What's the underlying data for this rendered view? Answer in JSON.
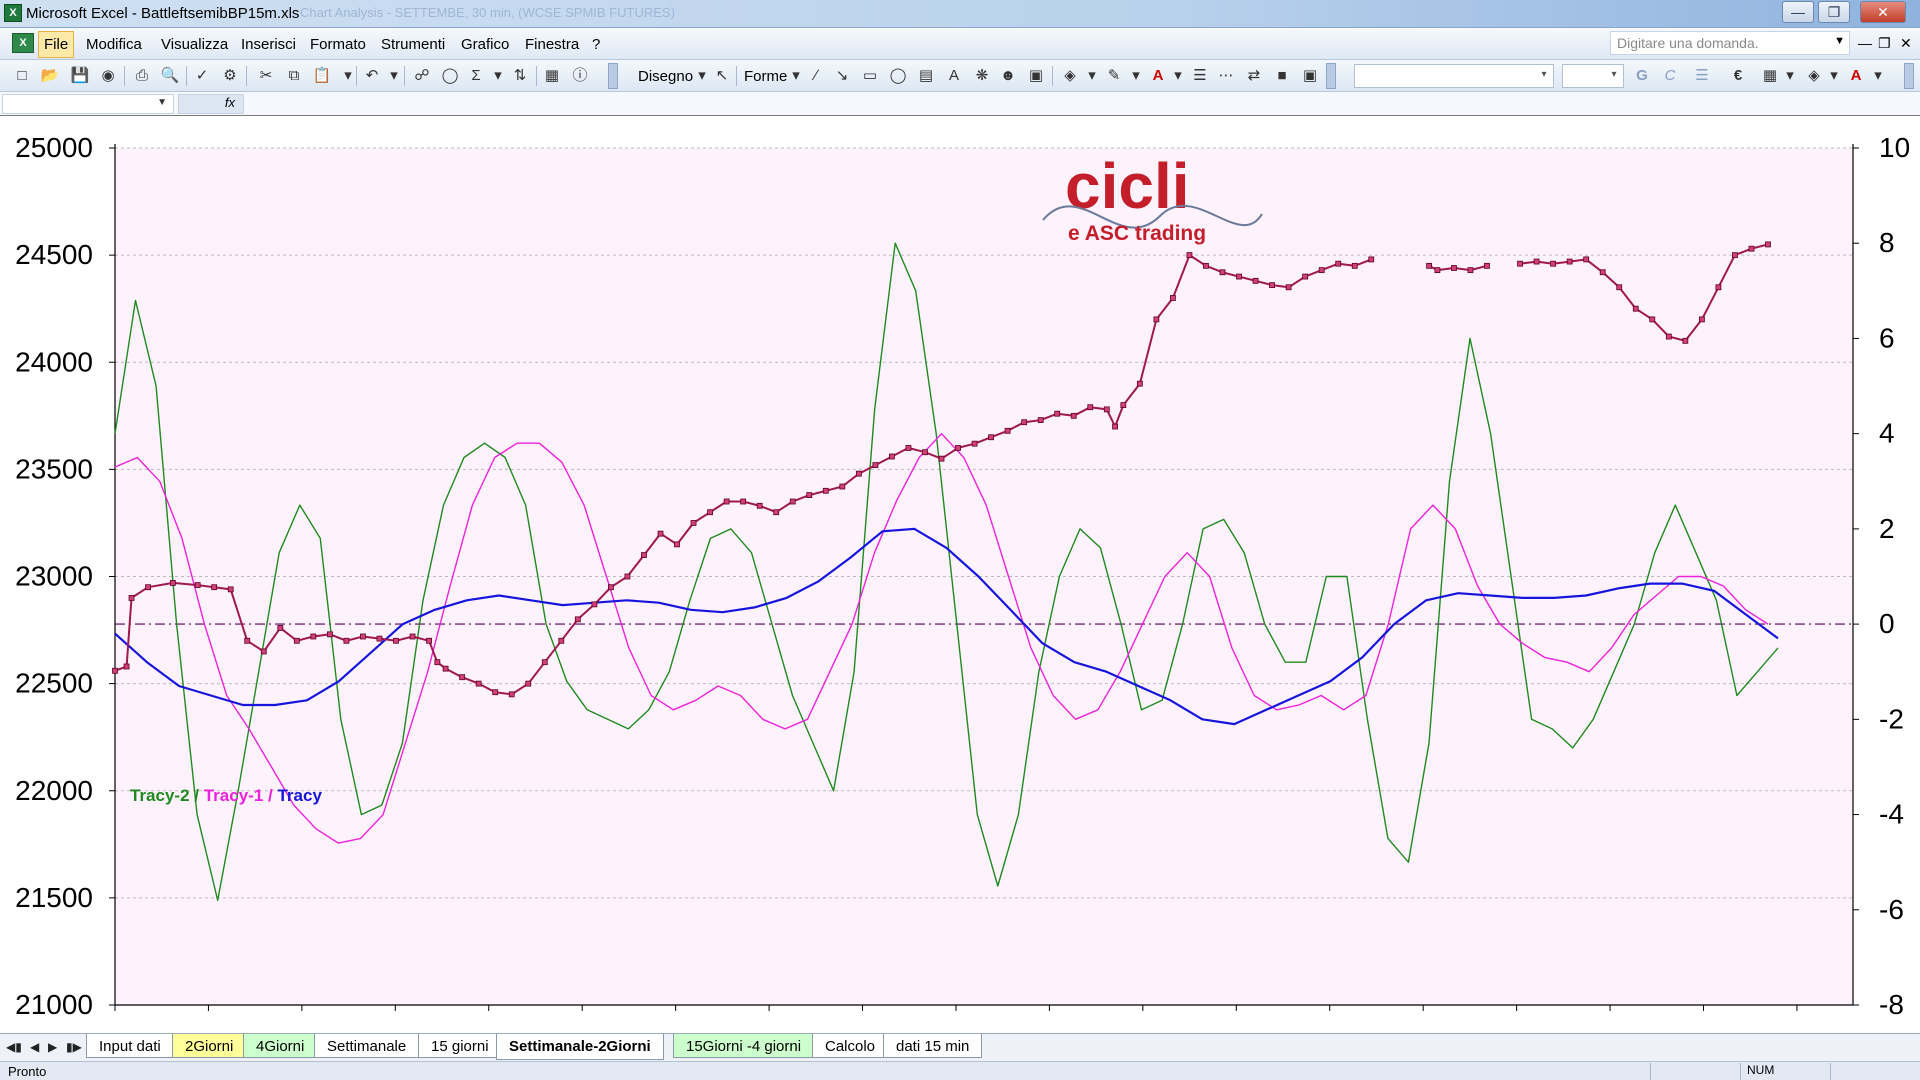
{
  "window": {
    "title": "Microsoft Excel - BattleftsemibBP15m.xls",
    "ghost_title": "Chart Analysis - SETTEMBE, 30 min, (WCSE SPMIB FUTURES)"
  },
  "menu": {
    "items": [
      "File",
      "Modifica",
      "Visualizza",
      "Inserisci",
      "Formato",
      "Strumenti",
      "Grafico",
      "Finestra",
      "?"
    ],
    "help_placeholder": "Digitare una domanda."
  },
  "toolbar": {
    "disegno_label": "Disegno",
    "forme_label": "Forme"
  },
  "sheet_tabs": [
    "Input dati",
    "2Giorni",
    "4Giorni",
    "Settimanale",
    "15 giorni",
    "Settimanale-2Giorni",
    "15Giorni -4 giorni",
    "Calcolo",
    "dati 15 min"
  ],
  "active_tab": "Settimanale-2Giorni",
  "status": {
    "left": "Pronto",
    "num": "NUM"
  },
  "logo": {
    "main": "cicli",
    "sub": "e ASC trading"
  },
  "colors": {
    "plot_bg": "#fef2fc",
    "price": "#a01850",
    "tracy2": "#1f8a1f",
    "tracy1": "#ee22dd",
    "tracy": "#1515dd",
    "zero_line": "#7a2a7a",
    "logo_red": "#c41e2a"
  },
  "chart_data": {
    "type": "line",
    "legend": [
      {
        "text": "Tracy-2",
        "color": "#1f8a1f"
      },
      {
        "text": "Tracy-1",
        "color": "#ee22dd"
      },
      {
        "text": "Tracy",
        "color": "#1515dd"
      }
    ],
    "y_left": {
      "min": 21000,
      "max": 25000,
      "step": 500,
      "ticks": [
        "25000",
        "24500",
        "24000",
        "23500",
        "23000",
        "22500",
        "22000",
        "21500",
        "21000"
      ]
    },
    "y_right": {
      "min": -8,
      "max": 10,
      "step": 2,
      "ticks": [
        "10",
        "8",
        "6",
        "4",
        "2",
        "0",
        "-2",
        "-4",
        "-6",
        "-8"
      ]
    },
    "x_range": [
      0,
      100
    ],
    "grid": true,
    "zero_line_right": 0,
    "price": [
      [
        0,
        22560
      ],
      [
        0.7,
        22580
      ],
      [
        1,
        22900
      ],
      [
        2,
        22950
      ],
      [
        3.5,
        22970
      ],
      [
        5,
        22960
      ],
      [
        6,
        22950
      ],
      [
        7,
        22940
      ],
      [
        8,
        22700
      ],
      [
        9,
        22650
      ],
      [
        10,
        22760
      ],
      [
        11,
        22700
      ],
      [
        12,
        22720
      ],
      [
        13,
        22730
      ],
      [
        14,
        22700
      ],
      [
        15,
        22720
      ],
      [
        16,
        22710
      ],
      [
        17,
        22700
      ],
      [
        18,
        22720
      ],
      [
        19,
        22700
      ],
      [
        19.5,
        22600
      ],
      [
        20,
        22570
      ],
      [
        21,
        22530
      ],
      [
        22,
        22500
      ],
      [
        23,
        22460
      ],
      [
        24,
        22450
      ],
      [
        25,
        22500
      ],
      [
        26,
        22600
      ],
      [
        27,
        22700
      ],
      [
        28,
        22800
      ],
      [
        29,
        22870
      ],
      [
        30,
        22950
      ],
      [
        31,
        23000
      ],
      [
        32,
        23100
      ],
      [
        33,
        23200
      ],
      [
        34,
        23150
      ],
      [
        35,
        23250
      ],
      [
        36,
        23300
      ],
      [
        37,
        23350
      ],
      [
        38,
        23350
      ],
      [
        39,
        23330
      ],
      [
        40,
        23300
      ],
      [
        41,
        23350
      ],
      [
        42,
        23380
      ],
      [
        43,
        23400
      ],
      [
        44,
        23420
      ],
      [
        45,
        23480
      ],
      [
        46,
        23520
      ],
      [
        47,
        23560
      ],
      [
        48,
        23600
      ],
      [
        49,
        23580
      ],
      [
        50,
        23550
      ],
      [
        51,
        23600
      ],
      [
        52,
        23620
      ],
      [
        53,
        23650
      ],
      [
        54,
        23680
      ],
      [
        55,
        23720
      ],
      [
        56,
        23730
      ],
      [
        57,
        23760
      ],
      [
        58,
        23750
      ],
      [
        59,
        23790
      ],
      [
        60,
        23780
      ],
      [
        60.5,
        23700
      ],
      [
        61,
        23800
      ],
      [
        62,
        23900
      ],
      [
        63,
        24200
      ],
      [
        64,
        24300
      ],
      [
        65,
        24500
      ],
      [
        66,
        24450
      ],
      [
        67,
        24420
      ],
      [
        68,
        24400
      ],
      [
        69,
        24380
      ],
      [
        70,
        24360
      ],
      [
        71,
        24350
      ],
      [
        72,
        24400
      ],
      [
        73,
        24430
      ],
      [
        74,
        24460
      ],
      [
        75,
        24450
      ],
      [
        76,
        24480
      ],
      [
        79,
        null
      ],
      [
        79.5,
        24450
      ],
      [
        80,
        24430
      ],
      [
        81,
        24440
      ],
      [
        82,
        24430
      ],
      [
        83,
        24450
      ],
      [
        84,
        null
      ],
      [
        85,
        24460
      ],
      [
        86,
        24470
      ],
      [
        87,
        24460
      ],
      [
        88,
        24470
      ],
      [
        89,
        24480
      ],
      [
        90,
        24420
      ],
      [
        91,
        24350
      ],
      [
        92,
        24250
      ],
      [
        93,
        24200
      ],
      [
        94,
        24120
      ],
      [
        95,
        24100
      ],
      [
        96,
        24200
      ],
      [
        97,
        24350
      ],
      [
        98,
        24500
      ],
      [
        99,
        24530
      ],
      [
        100,
        24550
      ]
    ],
    "tracy2": [
      [
        0,
        4
      ],
      [
        1,
        6.8
      ],
      [
        2,
        5
      ],
      [
        3,
        0
      ],
      [
        4,
        -4
      ],
      [
        5,
        -5.8
      ],
      [
        6,
        -3.5
      ],
      [
        7,
        -1
      ],
      [
        8,
        1.5
      ],
      [
        9,
        2.5
      ],
      [
        10,
        1.8
      ],
      [
        11,
        -2
      ],
      [
        12,
        -4
      ],
      [
        13,
        -3.8
      ],
      [
        14,
        -2.5
      ],
      [
        15,
        0.5
      ],
      [
        16,
        2.5
      ],
      [
        17,
        3.5
      ],
      [
        18,
        3.8
      ],
      [
        19,
        3.5
      ],
      [
        20,
        2.5
      ],
      [
        21,
        0
      ],
      [
        22,
        -1.2
      ],
      [
        23,
        -1.8
      ],
      [
        24,
        -2
      ],
      [
        25,
        -2.2
      ],
      [
        26,
        -1.8
      ],
      [
        27,
        -1
      ],
      [
        28,
        0.5
      ],
      [
        29,
        1.8
      ],
      [
        30,
        2
      ],
      [
        31,
        1.5
      ],
      [
        32,
        0
      ],
      [
        33,
        -1.5
      ],
      [
        34,
        -2.5
      ],
      [
        35,
        -3.5
      ],
      [
        36,
        -1
      ],
      [
        37,
        4.5
      ],
      [
        38,
        8
      ],
      [
        39,
        7
      ],
      [
        40,
        4
      ],
      [
        41,
        0
      ],
      [
        42,
        -4
      ],
      [
        43,
        -5.5
      ],
      [
        44,
        -4
      ],
      [
        45,
        -1
      ],
      [
        46,
        1
      ],
      [
        47,
        2
      ],
      [
        48,
        1.6
      ],
      [
        49,
        0
      ],
      [
        50,
        -1.8
      ],
      [
        51,
        -1.6
      ],
      [
        52,
        0
      ],
      [
        53,
        2
      ],
      [
        54,
        2.2
      ],
      [
        55,
        1.5
      ],
      [
        56,
        0
      ],
      [
        57,
        -0.8
      ],
      [
        58,
        -0.8
      ],
      [
        59,
        1
      ],
      [
        60,
        1
      ],
      [
        61,
        -2
      ],
      [
        62,
        -4.5
      ],
      [
        63,
        -5
      ],
      [
        64,
        -2.5
      ],
      [
        65,
        3
      ],
      [
        66,
        6
      ],
      [
        67,
        4
      ],
      [
        68,
        1
      ],
      [
        69,
        -2
      ],
      [
        70,
        -2.2
      ],
      [
        71,
        -2.6
      ],
      [
        72,
        -2
      ],
      [
        73,
        -1
      ],
      [
        74,
        0
      ],
      [
        75,
        1.5
      ],
      [
        76,
        2.5
      ],
      [
        77,
        1.5
      ],
      [
        78,
        0.5
      ],
      [
        79,
        -1.5
      ],
      [
        80,
        -1
      ],
      [
        81,
        -0.5
      ]
    ],
    "tracy1": [
      [
        0,
        3.3
      ],
      [
        1,
        3.5
      ],
      [
        2,
        3
      ],
      [
        3,
        1.8
      ],
      [
        4,
        0
      ],
      [
        5,
        -1.5
      ],
      [
        6,
        -2.2
      ],
      [
        7,
        -3
      ],
      [
        8,
        -3.8
      ],
      [
        9,
        -4.3
      ],
      [
        10,
        -4.6
      ],
      [
        11,
        -4.5
      ],
      [
        12,
        -4
      ],
      [
        13,
        -2.5
      ],
      [
        14,
        -1
      ],
      [
        15,
        0.8
      ],
      [
        16,
        2.5
      ],
      [
        17,
        3.5
      ],
      [
        18,
        3.8
      ],
      [
        19,
        3.8
      ],
      [
        20,
        3.4
      ],
      [
        21,
        2.5
      ],
      [
        22,
        1
      ],
      [
        23,
        -0.5
      ],
      [
        24,
        -1.5
      ],
      [
        25,
        -1.8
      ],
      [
        26,
        -1.6
      ],
      [
        27,
        -1.3
      ],
      [
        28,
        -1.5
      ],
      [
        29,
        -2
      ],
      [
        30,
        -2.2
      ],
      [
        31,
        -2
      ],
      [
        32,
        -1
      ],
      [
        33,
        0
      ],
      [
        34,
        1.5
      ],
      [
        35,
        2.6
      ],
      [
        36,
        3.5
      ],
      [
        37,
        4
      ],
      [
        38,
        3.5
      ],
      [
        39,
        2.5
      ],
      [
        40,
        1
      ],
      [
        41,
        -0.5
      ],
      [
        42,
        -1.5
      ],
      [
        43,
        -2
      ],
      [
        44,
        -1.8
      ],
      [
        45,
        -1
      ],
      [
        46,
        0
      ],
      [
        47,
        1
      ],
      [
        48,
        1.5
      ],
      [
        49,
        1
      ],
      [
        50,
        -0.5
      ],
      [
        51,
        -1.5
      ],
      [
        52,
        -1.8
      ],
      [
        53,
        -1.7
      ],
      [
        54,
        -1.5
      ],
      [
        55,
        -1.8
      ],
      [
        56,
        -1.5
      ],
      [
        57,
        0
      ],
      [
        58,
        2
      ],
      [
        59,
        2.5
      ],
      [
        60,
        2
      ],
      [
        61,
        0.8
      ],
      [
        62,
        0
      ],
      [
        63,
        -0.4
      ],
      [
        64,
        -0.7
      ],
      [
        65,
        -0.8
      ],
      [
        66,
        -1
      ],
      [
        67,
        -0.5
      ],
      [
        68,
        0.2
      ],
      [
        69,
        0.6
      ],
      [
        70,
        1
      ],
      [
        71,
        1
      ],
      [
        72,
        0.8
      ],
      [
        73,
        0.3
      ],
      [
        74,
        0
      ]
    ],
    "tracy": [
      [
        0,
        -0.2
      ],
      [
        2,
        -0.8
      ],
      [
        4,
        -1.3
      ],
      [
        6,
        -1.5
      ],
      [
        8,
        -1.7
      ],
      [
        10,
        -1.7
      ],
      [
        12,
        -1.6
      ],
      [
        14,
        -1.2
      ],
      [
        16,
        -0.6
      ],
      [
        18,
        0
      ],
      [
        20,
        0.3
      ],
      [
        22,
        0.5
      ],
      [
        24,
        0.6
      ],
      [
        26,
        0.5
      ],
      [
        28,
        0.4
      ],
      [
        30,
        0.45
      ],
      [
        32,
        0.5
      ],
      [
        34,
        0.45
      ],
      [
        36,
        0.3
      ],
      [
        38,
        0.25
      ],
      [
        40,
        0.35
      ],
      [
        42,
        0.55
      ],
      [
        44,
        0.9
      ],
      [
        46,
        1.4
      ],
      [
        48,
        1.95
      ],
      [
        50,
        2.0
      ],
      [
        52,
        1.6
      ],
      [
        54,
        1.0
      ],
      [
        56,
        0.3
      ],
      [
        58,
        -0.4
      ],
      [
        60,
        -0.8
      ],
      [
        62,
        -1.0
      ],
      [
        64,
        -1.3
      ],
      [
        66,
        -1.6
      ],
      [
        68,
        -2.0
      ],
      [
        70,
        -2.1
      ],
      [
        72,
        -1.8
      ],
      [
        74,
        -1.5
      ],
      [
        76,
        -1.2
      ],
      [
        78,
        -0.7
      ],
      [
        80,
        0
      ],
      [
        82,
        0.5
      ],
      [
        84,
        0.65
      ],
      [
        86,
        0.6
      ],
      [
        88,
        0.55
      ],
      [
        90,
        0.55
      ],
      [
        92,
        0.6
      ],
      [
        94,
        0.75
      ],
      [
        96,
        0.85
      ],
      [
        98,
        0.85
      ],
      [
        100,
        0.7
      ],
      [
        102,
        0.2
      ],
      [
        104,
        -0.3
      ]
    ]
  }
}
